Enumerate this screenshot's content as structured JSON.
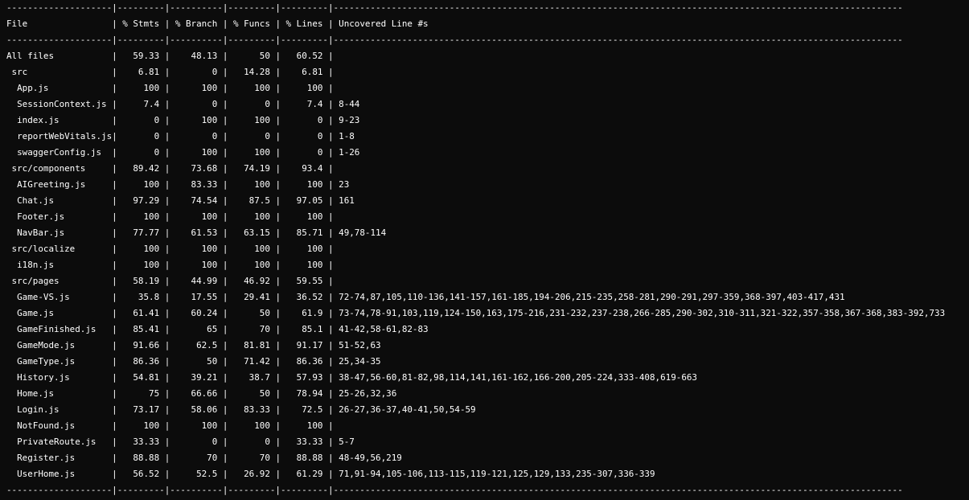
{
  "table": {
    "columns": [
      "File",
      "% Stmts",
      "% Branch",
      "% Funcs",
      "% Lines",
      "Uncovered Line #s"
    ],
    "rows": [
      {
        "file": "All files",
        "indent": 0,
        "stmts": "59.33",
        "branch": "48.13",
        "funcs": "50",
        "lines": "60.52",
        "uncovered": ""
      },
      {
        "file": "src",
        "indent": 1,
        "stmts": "6.81",
        "branch": "0",
        "funcs": "14.28",
        "lines": "6.81",
        "uncovered": ""
      },
      {
        "file": "App.js",
        "indent": 2,
        "stmts": "100",
        "branch": "100",
        "funcs": "100",
        "lines": "100",
        "uncovered": ""
      },
      {
        "file": "SessionContext.js",
        "indent": 2,
        "stmts": "7.4",
        "branch": "0",
        "funcs": "0",
        "lines": "7.4",
        "uncovered": "8-44"
      },
      {
        "file": "index.js",
        "indent": 2,
        "stmts": "0",
        "branch": "100",
        "funcs": "100",
        "lines": "0",
        "uncovered": "9-23"
      },
      {
        "file": "reportWebVitals.js",
        "indent": 2,
        "stmts": "0",
        "branch": "0",
        "funcs": "0",
        "lines": "0",
        "uncovered": "1-8"
      },
      {
        "file": "swaggerConfig.js",
        "indent": 2,
        "stmts": "0",
        "branch": "100",
        "funcs": "100",
        "lines": "0",
        "uncovered": "1-26"
      },
      {
        "file": "src/components",
        "indent": 1,
        "stmts": "89.42",
        "branch": "73.68",
        "funcs": "74.19",
        "lines": "93.4",
        "uncovered": ""
      },
      {
        "file": "AIGreeting.js",
        "indent": 2,
        "stmts": "100",
        "branch": "83.33",
        "funcs": "100",
        "lines": "100",
        "uncovered": "23"
      },
      {
        "file": "Chat.js",
        "indent": 2,
        "stmts": "97.29",
        "branch": "74.54",
        "funcs": "87.5",
        "lines": "97.05",
        "uncovered": "161"
      },
      {
        "file": "Footer.js",
        "indent": 2,
        "stmts": "100",
        "branch": "100",
        "funcs": "100",
        "lines": "100",
        "uncovered": ""
      },
      {
        "file": "NavBar.js",
        "indent": 2,
        "stmts": "77.77",
        "branch": "61.53",
        "funcs": "63.15",
        "lines": "85.71",
        "uncovered": "49,78-114"
      },
      {
        "file": "src/localize",
        "indent": 1,
        "stmts": "100",
        "branch": "100",
        "funcs": "100",
        "lines": "100",
        "uncovered": ""
      },
      {
        "file": "i18n.js",
        "indent": 2,
        "stmts": "100",
        "branch": "100",
        "funcs": "100",
        "lines": "100",
        "uncovered": ""
      },
      {
        "file": "src/pages",
        "indent": 1,
        "stmts": "58.19",
        "branch": "44.99",
        "funcs": "46.92",
        "lines": "59.55",
        "uncovered": ""
      },
      {
        "file": "Game-VS.js",
        "indent": 2,
        "stmts": "35.8",
        "branch": "17.55",
        "funcs": "29.41",
        "lines": "36.52",
        "uncovered": "72-74,87,105,110-136,141-157,161-185,194-206,215-235,258-281,290-291,297-359,368-397,403-417,431"
      },
      {
        "file": "Game.js",
        "indent": 2,
        "stmts": "61.41",
        "branch": "60.24",
        "funcs": "50",
        "lines": "61.9",
        "uncovered": "73-74,78-91,103,119,124-150,163,175-216,231-232,237-238,266-285,290-302,310-311,321-322,357-358,367-368,383-392,733"
      },
      {
        "file": "GameFinished.js",
        "indent": 2,
        "stmts": "85.41",
        "branch": "65",
        "funcs": "70",
        "lines": "85.1",
        "uncovered": "41-42,58-61,82-83"
      },
      {
        "file": "GameMode.js",
        "indent": 2,
        "stmts": "91.66",
        "branch": "62.5",
        "funcs": "81.81",
        "lines": "91.17",
        "uncovered": "51-52,63"
      },
      {
        "file": "GameType.js",
        "indent": 2,
        "stmts": "86.36",
        "branch": "50",
        "funcs": "71.42",
        "lines": "86.36",
        "uncovered": "25,34-35"
      },
      {
        "file": "History.js",
        "indent": 2,
        "stmts": "54.81",
        "branch": "39.21",
        "funcs": "38.7",
        "lines": "57.93",
        "uncovered": "38-47,56-60,81-82,98,114,141,161-162,166-200,205-224,333-408,619-663"
      },
      {
        "file": "Home.js",
        "indent": 2,
        "stmts": "75",
        "branch": "66.66",
        "funcs": "50",
        "lines": "78.94",
        "uncovered": "25-26,32,36"
      },
      {
        "file": "Login.js",
        "indent": 2,
        "stmts": "73.17",
        "branch": "58.06",
        "funcs": "83.33",
        "lines": "72.5",
        "uncovered": "26-27,36-37,40-41,50,54-59"
      },
      {
        "file": "NotFound.js",
        "indent": 2,
        "stmts": "100",
        "branch": "100",
        "funcs": "100",
        "lines": "100",
        "uncovered": ""
      },
      {
        "file": "PrivateRoute.js",
        "indent": 2,
        "stmts": "33.33",
        "branch": "0",
        "funcs": "0",
        "lines": "33.33",
        "uncovered": "5-7"
      },
      {
        "file": "Register.js",
        "indent": 2,
        "stmts": "88.88",
        "branch": "70",
        "funcs": "70",
        "lines": "88.88",
        "uncovered": "48-49,56,219"
      },
      {
        "file": "UserHome.js",
        "indent": 2,
        "stmts": "56.52",
        "branch": "52.5",
        "funcs": "26.92",
        "lines": "61.29",
        "uncovered": "71,91-94,105-106,113-115,119-121,125,129,133,235-307,336-339"
      }
    ]
  }
}
